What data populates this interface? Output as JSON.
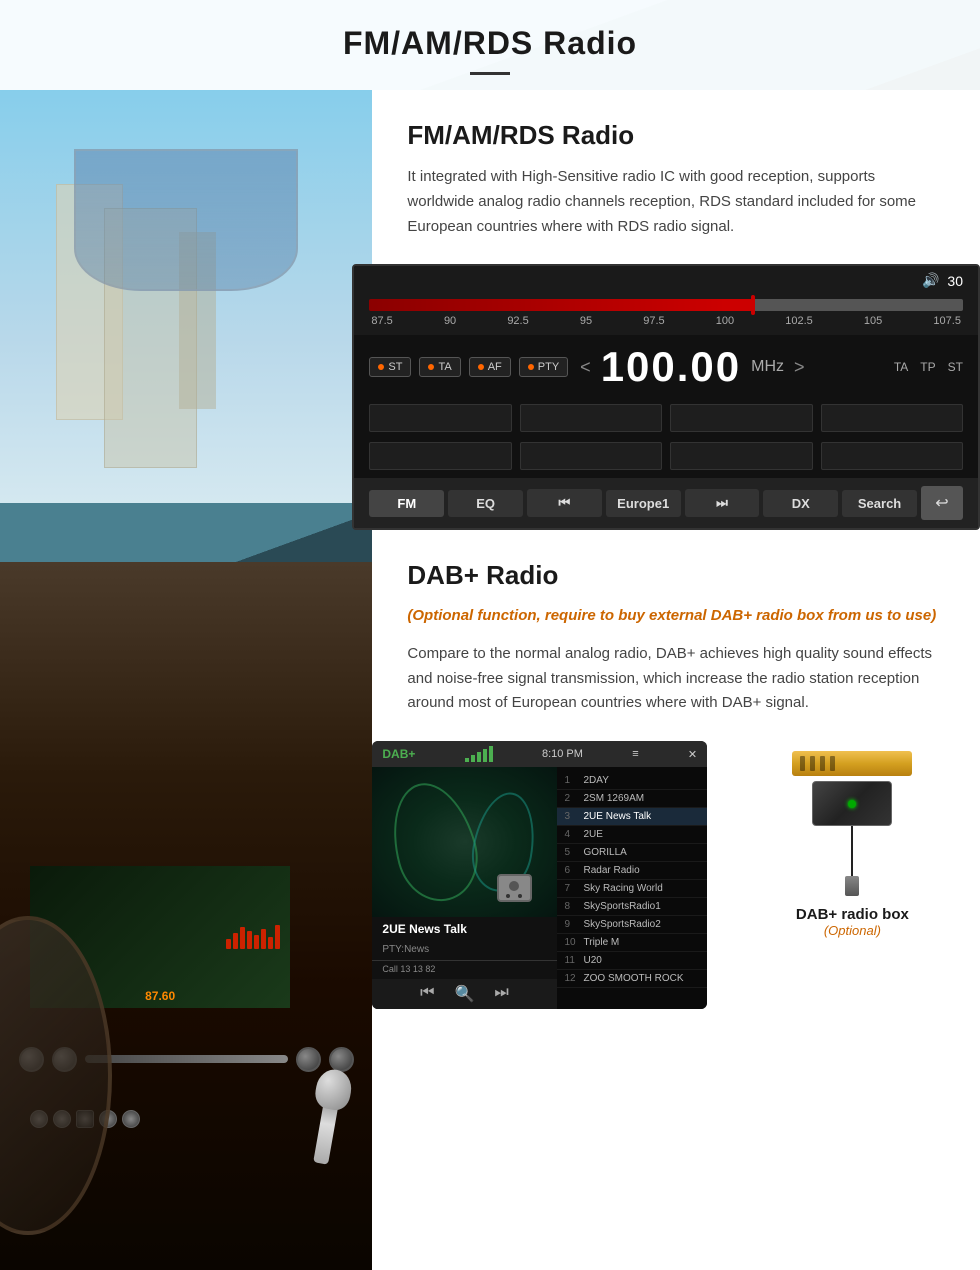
{
  "page": {
    "title": "FM/AM/RDS Radio",
    "header_divider": true
  },
  "fm_section": {
    "title": "FM/AM/RDS Radio",
    "description": "It integrated with High-Sensitive radio IC with good reception, supports worldwide analog radio channels reception, RDS standard included for some European countries where with RDS radio signal."
  },
  "radio_ui": {
    "volume": "30",
    "frequency_scale": [
      "87.5",
      "90",
      "92.5",
      "95",
      "97.5",
      "100",
      "102.5",
      "105",
      "107.5"
    ],
    "current_freq": "100.00",
    "freq_unit": "MHz",
    "mode_buttons": [
      "ST",
      "TA",
      "AF",
      "PTY"
    ],
    "right_labels": [
      "TA",
      "TP",
      "ST"
    ],
    "bottom_buttons": [
      "FM",
      "EQ",
      "⏮",
      "Europe1",
      "⏭",
      "DX",
      "Search"
    ],
    "back_button": "↩"
  },
  "dab_section": {
    "title": "DAB+ Radio",
    "optional_text": "(Optional function, require to buy external DAB+ radio box from us to use)",
    "description": "Compare to the normal analog radio, DAB+ achieves high quality sound effects and noise-free signal transmission, which increase the radio station reception around most of European countries where with DAB+ signal."
  },
  "dab_ui": {
    "label": "DAB+",
    "time": "8:10 PM",
    "station_name": "2UE News Talk",
    "pty": "PTY:News",
    "call": "Call 13 13 82",
    "stations": [
      {
        "num": "1",
        "name": "2DAY"
      },
      {
        "num": "2",
        "name": "2SM 1269AM"
      },
      {
        "num": "3",
        "name": "2UE News Talk",
        "active": true
      },
      {
        "num": "4",
        "name": "2UE"
      },
      {
        "num": "5",
        "name": "GORILLA"
      },
      {
        "num": "6",
        "name": "Radar Radio"
      },
      {
        "num": "7",
        "name": "Sky Racing World"
      },
      {
        "num": "8",
        "name": "SkySportsRadio1"
      },
      {
        "num": "9",
        "name": "SkySportsRadio2"
      },
      {
        "num": "10",
        "name": "Triple M"
      },
      {
        "num": "11",
        "name": "U20"
      },
      {
        "num": "12",
        "name": "ZOO SMOOTH ROCK"
      }
    ]
  },
  "dab_box": {
    "label": "DAB+ radio box",
    "sublabel": "(Optional)"
  },
  "colors": {
    "accent_orange": "#cc6600",
    "radio_red": "#cc0000",
    "dab_green": "#4CAF50",
    "text_dark": "#1a1a1a"
  }
}
